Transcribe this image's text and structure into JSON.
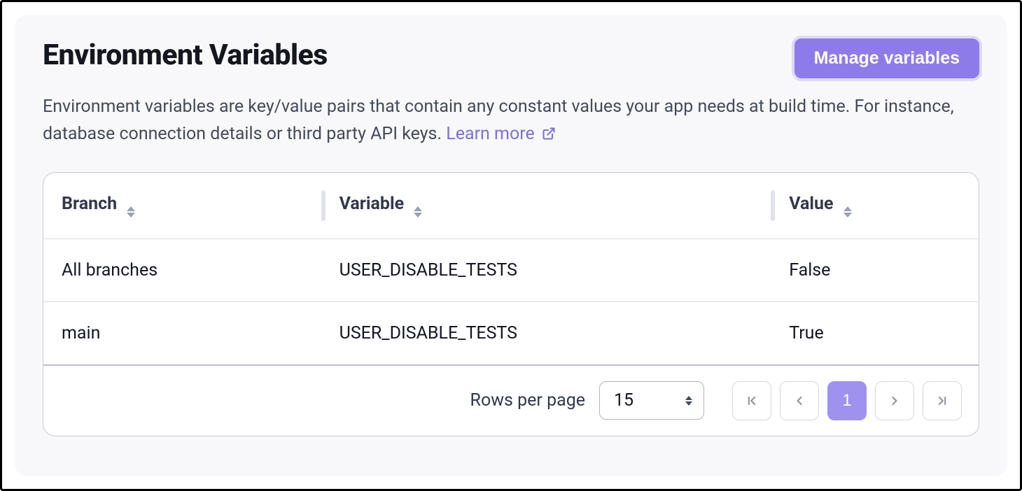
{
  "header": {
    "title": "Environment Variables",
    "manage_button": "Manage variables"
  },
  "description": {
    "text": "Environment variables are key/value pairs that contain any constant values your app needs at build time. For instance, database connection details or third party API keys. ",
    "learn_more": "Learn more"
  },
  "table": {
    "columns": {
      "branch": "Branch",
      "variable": "Variable",
      "value": "Value"
    },
    "rows": [
      {
        "branch": "All branches",
        "variable": "USER_DISABLE_TESTS",
        "value": "False"
      },
      {
        "branch": "main",
        "variable": "USER_DISABLE_TESTS",
        "value": "True"
      }
    ]
  },
  "pagination": {
    "rows_per_page_label": "Rows per page",
    "rows_per_page_value": "15",
    "current_page": "1"
  }
}
